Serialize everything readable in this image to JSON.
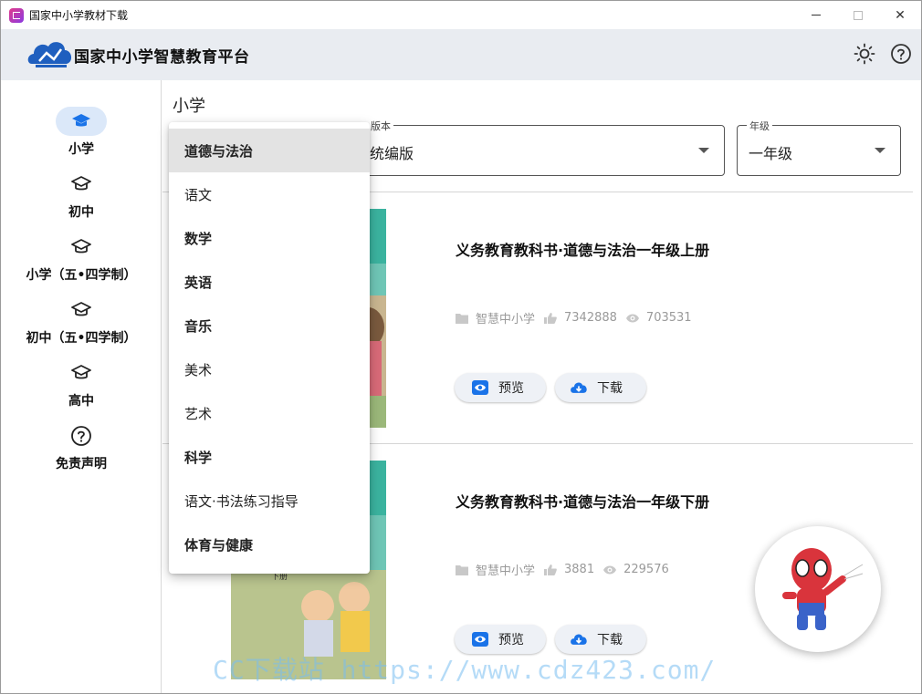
{
  "window": {
    "title": "国家中小学教材下载"
  },
  "header": {
    "brand": "国家中小学智慧教育平台"
  },
  "sidebar": {
    "items": [
      {
        "label": "小学",
        "icon": "graduation-cap-icon",
        "active": true
      },
      {
        "label": "初中",
        "icon": "graduation-cap-icon"
      },
      {
        "label": "小学（五•四学制）",
        "icon": "graduation-cap-icon"
      },
      {
        "label": "初中（五•四学制）",
        "icon": "graduation-cap-icon"
      },
      {
        "label": "高中",
        "icon": "graduation-cap-icon"
      },
      {
        "label": "免责声明",
        "icon": "help-circle-icon"
      }
    ]
  },
  "main": {
    "section_title": "小学",
    "filters": {
      "version": {
        "label": "版本",
        "value": "统编版"
      },
      "grade": {
        "label": "年级",
        "value": "一年级"
      }
    },
    "books": [
      {
        "title": "义务教育教科书·道德与法治一年级上册",
        "publisher": "智慧中小学",
        "likes": "7342888",
        "views": "703531",
        "preview_label": "预览",
        "download_label": "下载"
      },
      {
        "title": "义务教育教科书·道德与法治一年级下册",
        "publisher": "智慧中小学",
        "likes": "3881",
        "views": "229576",
        "preview_label": "预览",
        "download_label": "下载",
        "cover_text": "下册"
      }
    ]
  },
  "subject_dropdown": {
    "options": [
      "道德与法治",
      "语文",
      "数学",
      "英语",
      "音乐",
      "美术",
      "艺术",
      "科学",
      "语文·书法练习指导",
      "体育与健康"
    ],
    "selected": "道德与法治"
  },
  "watermark": "CC下载站 https://www.cdz423.com/",
  "colors": {
    "accent": "#1a73e8",
    "header_bg": "#e9ecf1",
    "active_nav_bg": "#dbe8f9",
    "button_bg": "#eef1f6"
  }
}
